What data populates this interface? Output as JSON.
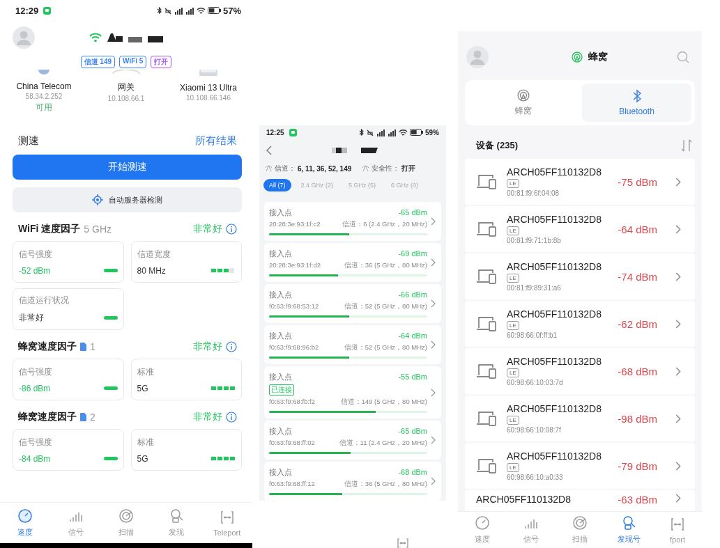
{
  "speed_screen": {
    "status_bar": {
      "time": "12:29",
      "battery": "57%"
    },
    "tags": [
      {
        "label": "信道 149",
        "color": "#3b82f6"
      },
      {
        "label": "WiFi 5",
        "color": "#3b82f6"
      },
      {
        "label": "打开",
        "color": "#a855f7"
      }
    ],
    "nodes": [
      {
        "name": "China Telecom",
        "address": "58.34.2.252",
        "status": "可用"
      },
      {
        "name": "网关",
        "address": "10.108.66.1"
      },
      {
        "name": "Xiaomi 13 Ultra",
        "address": "10.108.66.146"
      }
    ],
    "speed_test": {
      "title": "测速",
      "link": "所有结果",
      "start_button": "开始测速",
      "server_button": "自动服务器检测"
    },
    "factor_sections": [
      {
        "title": "WiFi 速度因子",
        "subtitle": "5 GHz",
        "rating": "非常好",
        "cards": [
          {
            "kind": "pill",
            "label": "信号强度",
            "value": "-52 dBm",
            "highlight": true
          },
          {
            "kind": "segments",
            "label": "信道宽度",
            "value": "80 MHz",
            "level": 0.75
          },
          {
            "kind": "pill",
            "label": "信道运行状况",
            "value": "非常好",
            "highlight": false
          }
        ]
      },
      {
        "title": "蜂窝速度因子",
        "sim": "1",
        "rating": "非常好",
        "cards": [
          {
            "kind": "pill",
            "label": "信号强度",
            "value": "-86 dBm",
            "highlight": true
          },
          {
            "kind": "segments",
            "label": "标准",
            "value": "5G",
            "level": 1
          }
        ]
      },
      {
        "title": "蜂窝速度因子",
        "sim": "2",
        "rating": "非常好",
        "cards": [
          {
            "kind": "pill",
            "label": "信号强度",
            "value": "-84 dBm",
            "highlight": true
          },
          {
            "kind": "segments",
            "label": "标准",
            "value": "5G",
            "level": 1
          }
        ]
      }
    ],
    "nav": [
      {
        "label": "速度",
        "selected": true
      },
      {
        "label": "信号",
        "selected": false
      },
      {
        "label": "扫描",
        "selected": false
      },
      {
        "label": "发现",
        "selected": false
      },
      {
        "label": "Teleport",
        "selected": false
      }
    ]
  },
  "wifi_detail_screen": {
    "status_bar": {
      "time": "12:25",
      "battery": "59%"
    },
    "info": [
      {
        "label": "信道：",
        "value": "6, 11, 36, 52, 149"
      },
      {
        "label": "安全性：",
        "value": "打开"
      }
    ],
    "filters": [
      {
        "label": "All (7)",
        "selected": true
      },
      {
        "label": "2.4 GHz (2)",
        "selected": false
      },
      {
        "label": "5 GHz (5)",
        "selected": false
      },
      {
        "label": "6 GHz (0)",
        "selected": false
      }
    ],
    "access_points": [
      {
        "label": "接入点",
        "rssi": "-65 dBm",
        "mac": "20:28:3e:93:1f:c2",
        "channel": "信道：6 (2.4 GHz，20 MHz)",
        "level": 0.5
      },
      {
        "label": "接入点",
        "rssi": "-69 dBm",
        "mac": "20:28:3e:93:1f:d2",
        "channel": "信道：36 (5 GHz，80 MHz)",
        "level": 0.43
      },
      {
        "label": "接入点",
        "rssi": "-66 dBm",
        "mac": "f0:63:f9:68:53:12",
        "channel": "信道：52 (5 GHz，80 MHz)",
        "level": 0.5
      },
      {
        "label": "接入点",
        "rssi": "-64 dBm",
        "mac": "f0:63:f9:68:96:b2",
        "channel": "信道：52 (5 GHz，80 MHz)",
        "level": 0.5
      },
      {
        "label": "接入点",
        "badge": "已连接",
        "rssi": "-55 dBm",
        "mac": "f0:63:f9:68:fb:f2",
        "channel": "信道：149 (5 GHz，80 MHz)",
        "level": 0.67
      },
      {
        "label": "接入点",
        "rssi": "-65 dBm",
        "mac": "f0:63:f9:68:ff:02",
        "channel": "信道：11 (2.4 GHz，20 MHz)",
        "level": 0.51
      },
      {
        "label": "接入点",
        "rssi": "-68 dBm",
        "mac": "f0:63:f9:68:ff:12",
        "channel": "信道：36 (5 GHz，80 MHz)",
        "level": 0.46
      }
    ]
  },
  "bluetooth_screen": {
    "title": "蜂窝",
    "tabs": [
      {
        "label": "蜂窝",
        "selected": false
      },
      {
        "label": "Bluetooth",
        "selected": true
      }
    ],
    "devices_title": "设备 (235)",
    "devices": [
      {
        "name": "ARCH05FF110132D8",
        "tag": "LE",
        "mac": "00:81:f9:6f:04:08",
        "rssi": "-75 dBm"
      },
      {
        "name": "ARCH05FF110132D8",
        "tag": "LE",
        "mac": "00:81:f9:71:1b:8b",
        "rssi": "-64 dBm"
      },
      {
        "name": "ARCH05FF110132D8",
        "tag": "LE",
        "mac": "00:81:f9:89:31:a6",
        "rssi": "-74 dBm"
      },
      {
        "name": "ARCH05FF110132D8",
        "tag": "LE",
        "mac": "60:98:66:0f:ff:b1",
        "rssi": "-62 dBm"
      },
      {
        "name": "ARCH05FF110132D8",
        "tag": "LE",
        "mac": "60:98:66:10:03:7d",
        "rssi": "-68 dBm"
      },
      {
        "name": "ARCH05FF110132D8",
        "tag": "LE",
        "mac": "60:98:66:10:08:7f",
        "rssi": "-98 dBm"
      },
      {
        "name": "ARCH05FF110132D8",
        "tag": "LE",
        "mac": "60:98:66:10:a0:33",
        "rssi": "-79 dBm"
      },
      {
        "name": "ARCH05FF110132D8",
        "rssi": "-63 dBm"
      }
    ],
    "nav": [
      {
        "label": "速度",
        "selected": false
      },
      {
        "label": "信号",
        "selected": false
      },
      {
        "label": "扫描",
        "selected": false
      },
      {
        "label": "发现号",
        "selected": true
      },
      {
        "label": "fport",
        "selected": false
      }
    ]
  }
}
